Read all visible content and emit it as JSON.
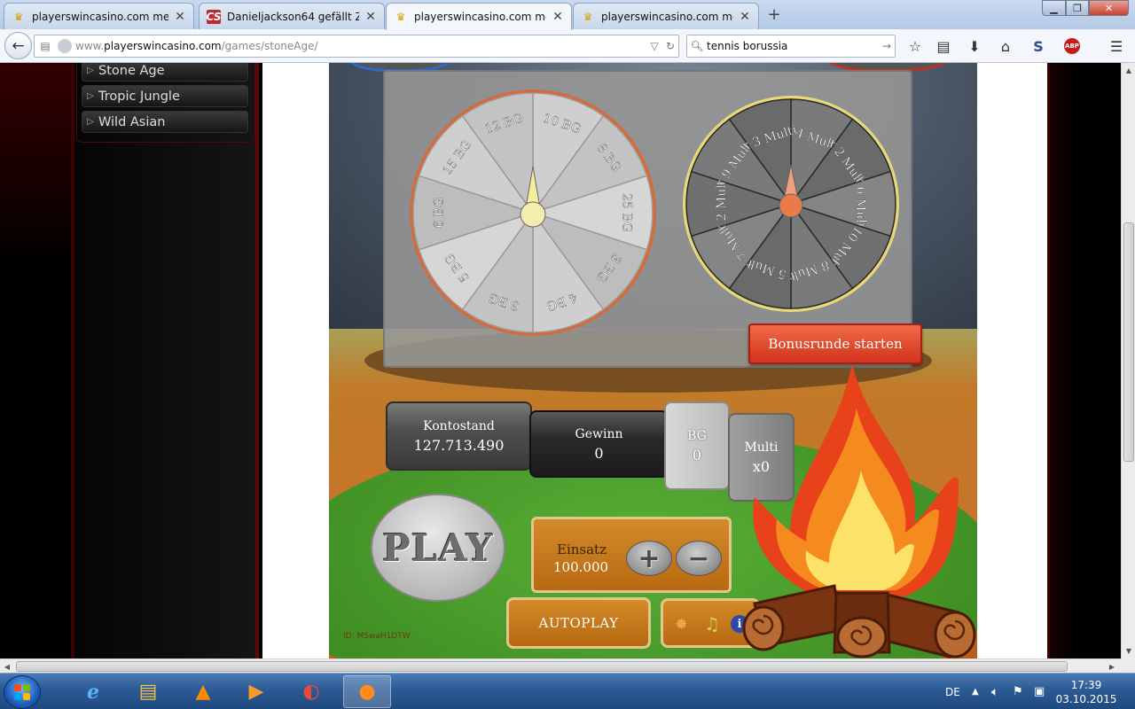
{
  "browser": {
    "tabs": [
      {
        "title": "playerswincasino.com me...",
        "icon": "crown-icon",
        "active": false
      },
      {
        "title": "Danieljackson64 gefällt Zo...",
        "icon": "cs-icon",
        "icon_text": "CS",
        "active": false
      },
      {
        "title": "playerswincasino.com me...",
        "icon": "crown-icon",
        "active": true
      },
      {
        "title": "playerswincasino.com me...",
        "icon": "crown-icon",
        "active": false
      }
    ],
    "url_prefix": "www.",
    "url_host": "playerswincasino.com",
    "url_path": "/games/stoneAge/",
    "search_value": "tennis borussia",
    "abp_label": "ABP"
  },
  "sidebar": {
    "items": [
      {
        "label": "Stone Age"
      },
      {
        "label": "Tropic Jungle"
      },
      {
        "label": "Wild Asian"
      }
    ]
  },
  "game": {
    "bg_wheel": [
      "10 BG",
      "8 BG",
      "25 BG",
      "3 BG",
      "4 BG",
      "3 BG",
      "5 BG",
      "6 BG",
      "15 BG",
      "12 BG"
    ],
    "multi_wheel": [
      "x 4 Multi",
      "x 2 Multi",
      "x 6 Multi",
      "x 10 Multi",
      "x 8 Multi",
      "x 5 Multi",
      "x 7 Multi",
      "x 2 Multi",
      "x 9 Multi",
      "x 3 Multi"
    ],
    "bonus_button": "Bonusrunde starten",
    "kontostand_label": "Kontostand",
    "kontostand_value": "127.713.490",
    "gewinn_label": "Gewinn",
    "gewinn_value": "0",
    "bg_label": "BG",
    "bg_value": "0",
    "multi_label": "Multi",
    "multi_value": "x0",
    "play_label": "PLAY",
    "einsatz_label": "Einsatz",
    "einsatz_value": "100.000",
    "plus_label": "+",
    "minus_label": "−",
    "autoplay_label": "AUTOPLAY",
    "info_label": "i",
    "id_text": "ID: MSwaH1DTW"
  },
  "taskbar": {
    "language": "DE",
    "time": "17:39",
    "date": "03.10.2015"
  },
  "colors": {
    "accent_red": "#d2331c",
    "panel_orange": "#c67a1c",
    "hill_green": "#4ea12e",
    "bg_wheel_rim": "#d66a3a",
    "multi_wheel_rim": "#e8d87a"
  }
}
